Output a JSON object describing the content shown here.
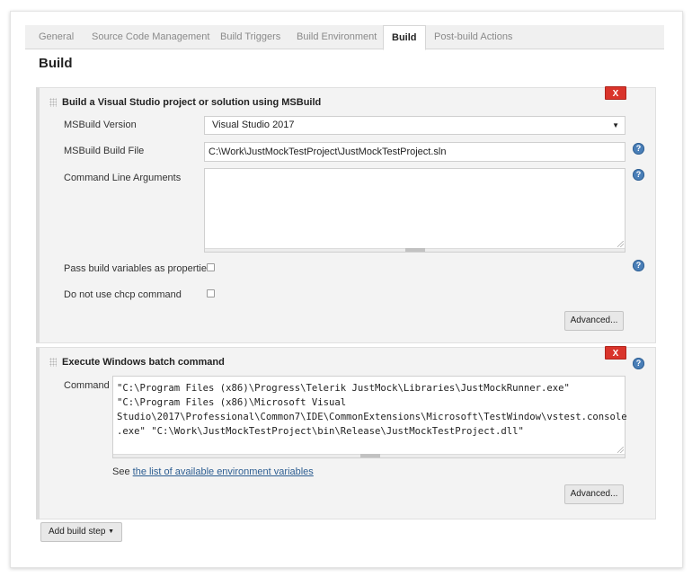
{
  "tabs": [
    {
      "label": "General",
      "active": false
    },
    {
      "label": "Source Code Management",
      "active": false
    },
    {
      "label": "Build Triggers",
      "active": false
    },
    {
      "label": "Build Environment",
      "active": false
    },
    {
      "label": "Build",
      "active": true
    },
    {
      "label": "Post-build Actions",
      "active": false
    }
  ],
  "section_title": "Build",
  "msbuild_step": {
    "title": "Build a Visual Studio project or solution using MSBuild",
    "remove_label": "X",
    "version_label": "MSBuild Version",
    "version_value": "Visual Studio 2017",
    "build_file_label": "MSBuild Build File",
    "build_file_value": "C:\\Work\\JustMockTestProject\\JustMockTestProject.sln",
    "cmd_args_label": "Command Line Arguments",
    "cmd_args_value": "",
    "pass_vars_label": "Pass build variables as properties",
    "pass_vars_checked": false,
    "no_chcp_label": "Do not use chcp command",
    "no_chcp_checked": false,
    "advanced_label": "Advanced..."
  },
  "batch_step": {
    "title": "Execute Windows batch command",
    "remove_label": "X",
    "command_label": "Command",
    "command_lines": [
      "\"C:\\Program Files (x86)\\Progress\\Telerik JustMock\\Libraries\\JustMockRunner.exe\"",
      "\"C:\\Program Files (x86)\\Microsoft Visual",
      "Studio\\2017\\Professional\\Common7\\IDE\\CommonExtensions\\Microsoft\\TestWindow\\vstest.console",
      ".exe\" \"C:\\Work\\JustMockTestProject\\bin\\Release\\JustMockTestProject.dll\""
    ],
    "see_prefix": "See",
    "see_link": "the list of available environment variables",
    "advanced_label": "Advanced..."
  },
  "add_build_step_label": "Add build step",
  "help_glyph": "?",
  "colors": {
    "remove_button": "#d9342b",
    "help_icon": "#4a7fb8",
    "link": "#2c5d91"
  }
}
